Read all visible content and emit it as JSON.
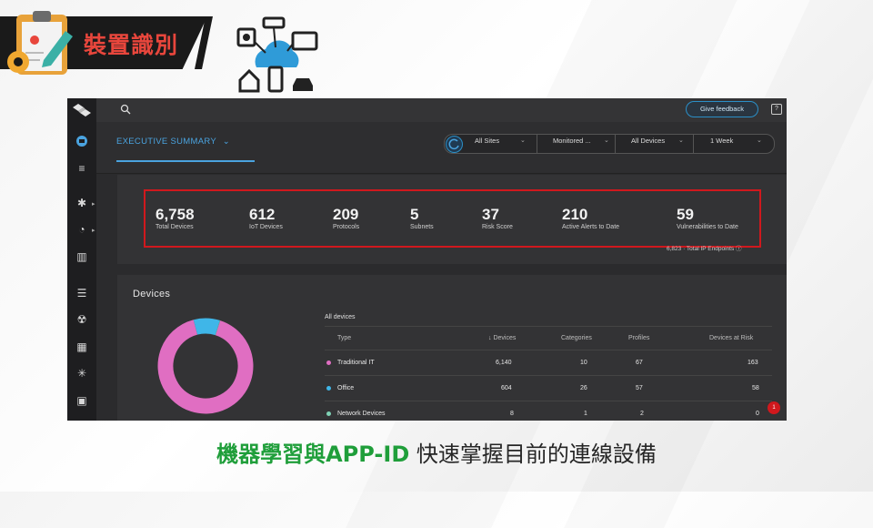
{
  "header": {
    "title": "裝置識別"
  },
  "app": {
    "feedback_label": "Give feedback",
    "help_glyph": "?",
    "tab_label": "EXECUTIVE SUMMARY",
    "tab_caret": "⌄",
    "filters": [
      "All Sites",
      "Monitored ...",
      "All Devices",
      "1 Week"
    ]
  },
  "stats": [
    {
      "value": "6,758",
      "label": "Total Devices"
    },
    {
      "value": "612",
      "label": "IoT Devices"
    },
    {
      "value": "209",
      "label": "Protocols"
    },
    {
      "value": "5",
      "label": "Subnets"
    },
    {
      "value": "37",
      "label": "Risk Score"
    },
    {
      "value": "210",
      "label": "Active Alerts to Date"
    },
    {
      "value": "59",
      "label": "Vulnerabilities to Date"
    }
  ],
  "endpoint_note": "6,823 · Total IP Endpoints ⓘ",
  "devices": {
    "title": "Devices",
    "subtitle": "All devices",
    "columns": [
      "Type",
      "↓ Devices",
      "Categories",
      "Profiles",
      "Devices at Risk"
    ],
    "rows": [
      {
        "type": "Traditional IT",
        "devices": "6,140",
        "categories": "10",
        "profiles": "67",
        "at_risk": "163",
        "color": "#e06ec2"
      },
      {
        "type": "Office",
        "devices": "604",
        "categories": "26",
        "profiles": "57",
        "at_risk": "58",
        "color": "#3fb6e8"
      },
      {
        "type": "Network Devices",
        "devices": "8",
        "categories": "1",
        "profiles": "2",
        "at_risk": "0",
        "color": "#7fd1b5"
      }
    ],
    "donut": {
      "segments": [
        {
          "fraction": 0.908,
          "color": "#e06ec2"
        },
        {
          "fraction": 0.089,
          "color": "#3fb6e8"
        },
        {
          "fraction": 0.003,
          "color": "#7fd1b5"
        }
      ]
    }
  },
  "notification_count": "1",
  "caption": {
    "highlight": "機器學習與APP-ID",
    "rest": " 快速掌握目前的連線設備"
  }
}
